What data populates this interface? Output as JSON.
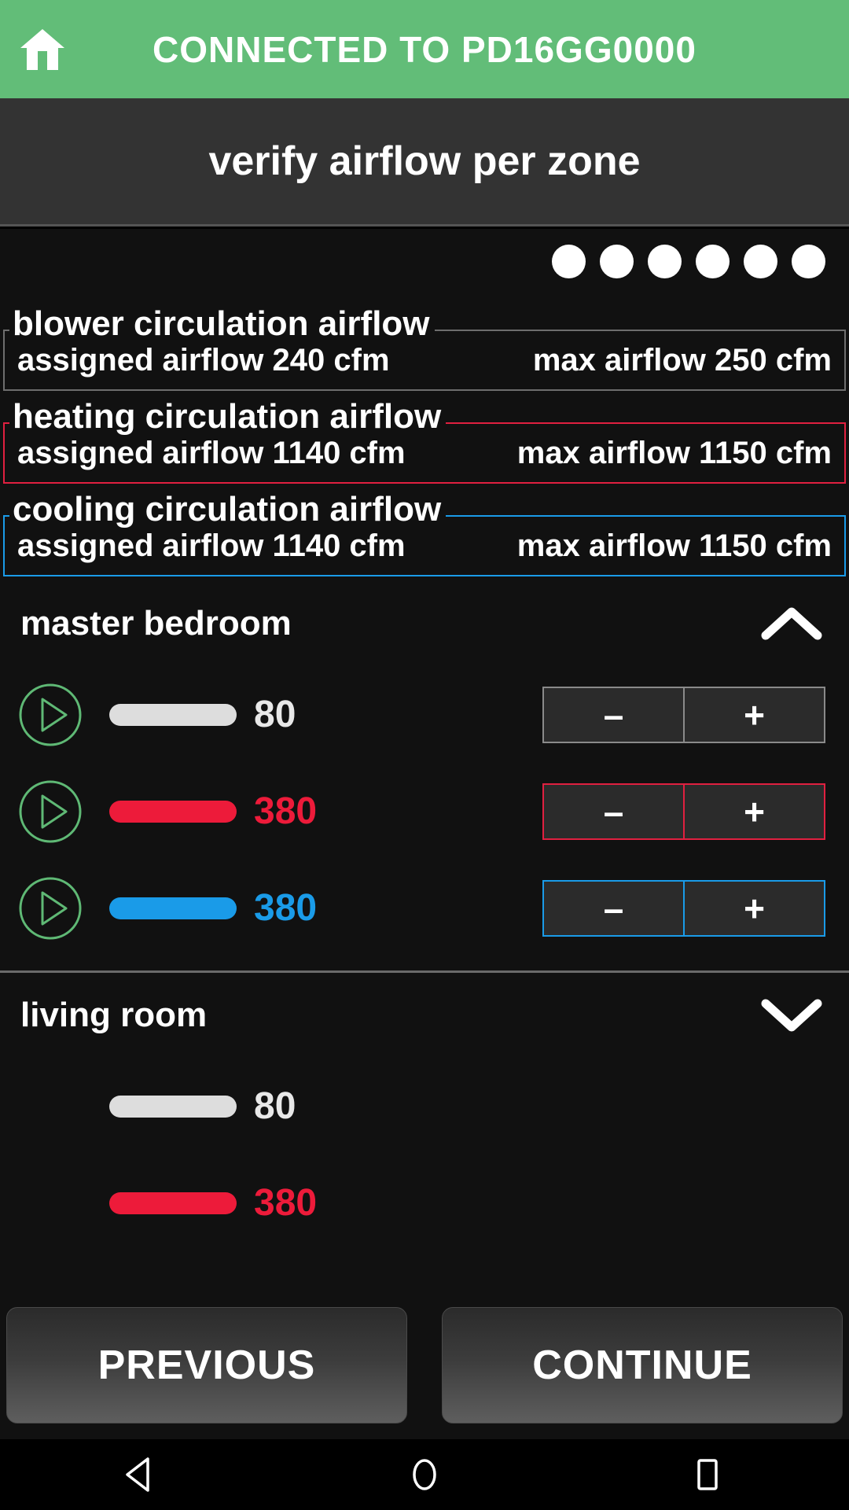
{
  "statusbar": {
    "home_icon": "home-icon",
    "title": "CONNECTED TO PD16GG0000",
    "background_color": "#62bd78"
  },
  "page": {
    "title": "verify airflow per zone"
  },
  "progress": {
    "dot_count": 6,
    "dots": [
      "1",
      "2",
      "3",
      "4",
      "5",
      "6"
    ],
    "dot_color": "#ffffff"
  },
  "summary": {
    "boxes": [
      {
        "legend": "blower circulation airflow",
        "assigned": "assigned airflow 240 cfm",
        "max": "max airflow 250 cfm",
        "accent": "#6e6e6e",
        "variant": ""
      },
      {
        "legend": "heating circulation airflow",
        "assigned": "assigned airflow 1140 cfm",
        "max": "max airflow 1150 cfm",
        "accent": "#e02040",
        "variant": "red"
      },
      {
        "legend": "cooling circulation airflow",
        "assigned": "assigned airflow 1140 cfm",
        "max": "max airflow 1150 cfm",
        "accent": "#1a9be8",
        "variant": "blue"
      }
    ]
  },
  "zones": [
    {
      "name": "master bedroom",
      "expanded": true,
      "chevron": "chevron-up-icon",
      "rows": [
        {
          "play": "play-icon",
          "has_play": true,
          "value": "80",
          "bar_fill_pct": 100,
          "color": "#dddddd",
          "variant": "",
          "minus": "–",
          "plus": "+"
        },
        {
          "play": "play-icon",
          "has_play": true,
          "value": "380",
          "bar_fill_pct": 100,
          "color": "#ed1b3a",
          "variant": "red",
          "minus": "–",
          "plus": "+"
        },
        {
          "play": "play-icon",
          "has_play": true,
          "value": "380",
          "bar_fill_pct": 100,
          "color": "#1a9be8",
          "variant": "blue",
          "minus": "–",
          "plus": "+"
        }
      ]
    },
    {
      "name": "living room",
      "expanded": false,
      "chevron": "chevron-down-icon",
      "rows": [
        {
          "play": "play-icon",
          "has_play": false,
          "value": "80",
          "bar_fill_pct": 100,
          "color": "#dddddd",
          "variant": "",
          "minus": "–",
          "plus": "+"
        },
        {
          "play": "play-icon",
          "has_play": false,
          "value": "380",
          "bar_fill_pct": 100,
          "color": "#ed1b3a",
          "variant": "red",
          "minus": "–",
          "plus": "+"
        }
      ]
    }
  ],
  "footer": {
    "previous_label": "PREVIOUS",
    "continue_label": "CONTINUE"
  },
  "android_nav": {
    "back": "back-triangle-icon",
    "home": "home-circle-icon",
    "recents": "recents-square-icon"
  }
}
